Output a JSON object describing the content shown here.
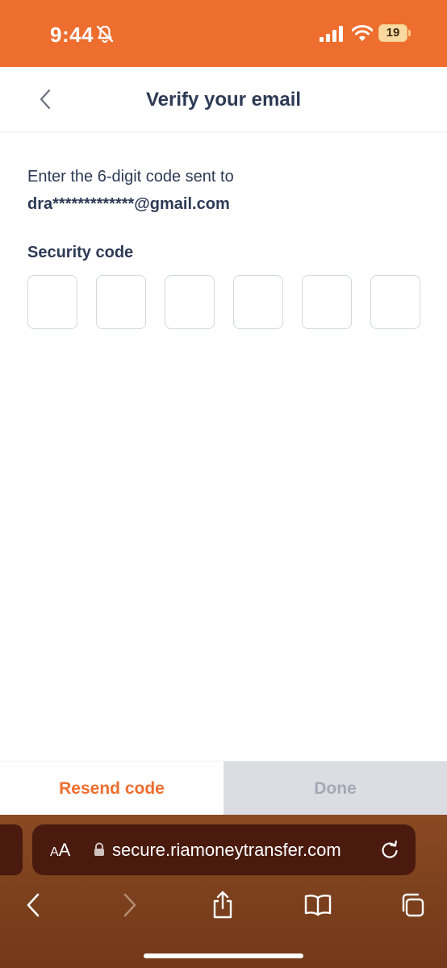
{
  "status_bar": {
    "time": "9:44",
    "battery_level": "19",
    "icons": [
      "bell-slash-icon",
      "signal-icon",
      "wifi-icon",
      "battery-icon"
    ],
    "background_color": "#ee6e2f"
  },
  "header": {
    "title": "Verify your email",
    "back_icon": "chevron-left-icon"
  },
  "instructions": {
    "line1": "Enter the 6-digit code sent to",
    "email": "dra*************@gmail.com"
  },
  "security_code": {
    "label": "Security code",
    "digits": [
      "",
      "",
      "",
      "",
      "",
      ""
    ]
  },
  "actions": {
    "resend_label": "Resend code",
    "done_label": "Done",
    "accent_color": "#ee6e2f"
  },
  "browser": {
    "aa_label_small": "A",
    "aa_label_large": "A",
    "url": "secure.riamoneytransfer.com",
    "nav_icons": [
      "back-icon",
      "forward-icon",
      "share-icon",
      "bookmarks-icon",
      "tabs-icon"
    ]
  }
}
